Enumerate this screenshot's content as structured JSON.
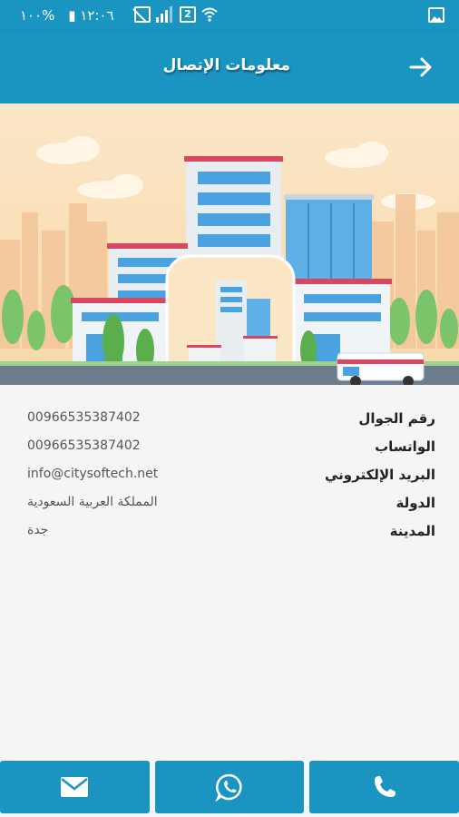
{
  "status_bar": {
    "time": "١٢:٠٦",
    "battery": "%١٠٠",
    "icons": [
      "battery-icon",
      "no-sim-icon",
      "signal-icon",
      "sim-2-icon",
      "wifi-icon",
      "gallery-icon"
    ]
  },
  "app_bar": {
    "title": "معلومات الإتصال",
    "back_icon": "arrow-right-icon"
  },
  "contact": {
    "rows": [
      {
        "label": "رقم الجوال",
        "value": "00966535387402"
      },
      {
        "label": "الواتساب",
        "value": "00966535387402"
      },
      {
        "label": "البريد الإلكتروني",
        "value": "info@citysoftech.net"
      },
      {
        "label": "الدولة",
        "value": "المملكة العربية السعودية"
      },
      {
        "label": "المدينة",
        "value": "جدة"
      }
    ]
  },
  "bottom_bar": {
    "buttons": [
      {
        "icon": "mail-icon"
      },
      {
        "icon": "whatsapp-icon"
      },
      {
        "icon": "phone-icon"
      }
    ]
  },
  "colors": {
    "primary": "#1a94c0",
    "background": "#f5f5f5"
  }
}
